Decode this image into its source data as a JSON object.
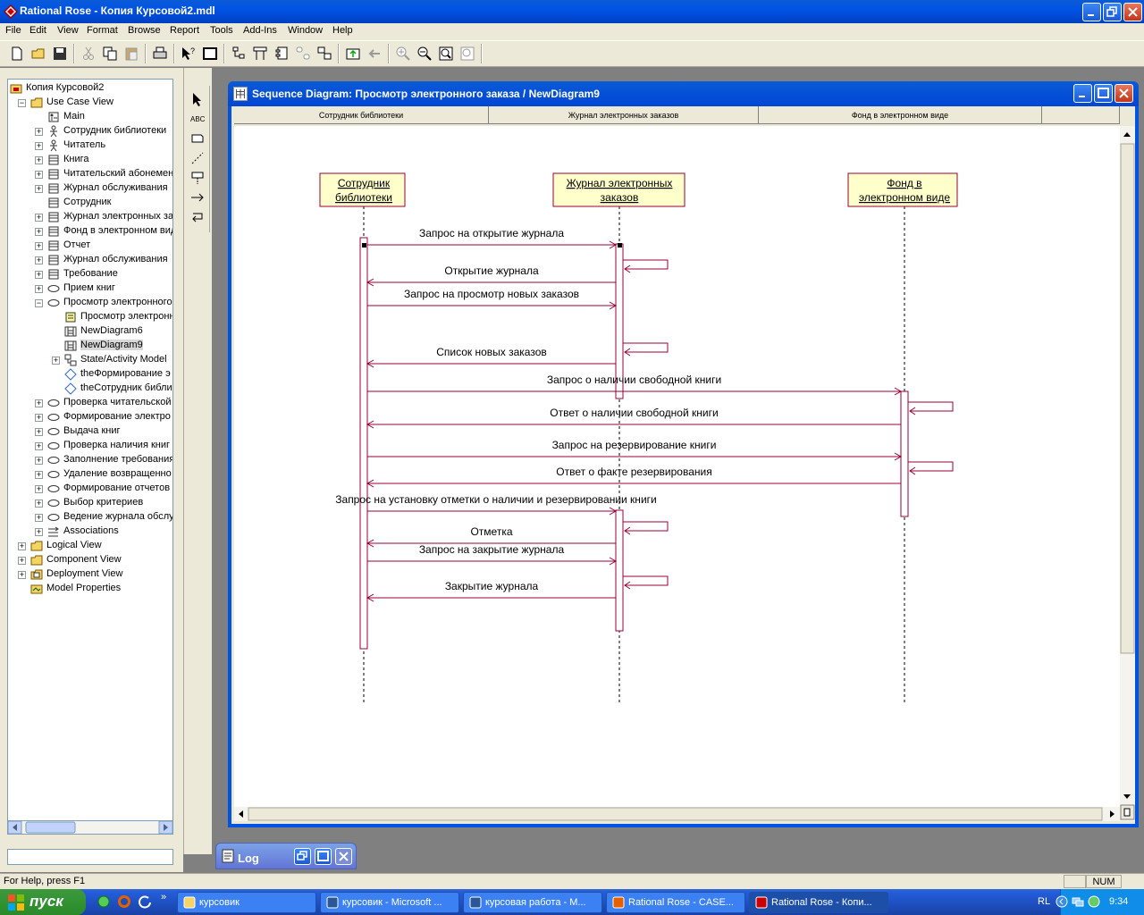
{
  "app": {
    "title": "Rational Rose - Копия Курсовой2.mdl"
  },
  "menu": [
    "File",
    "Edit",
    "View",
    "Format",
    "Browse",
    "Report",
    "Tools",
    "Add-Ins",
    "Window",
    "Help"
  ],
  "browser": {
    "items": [
      {
        "label": "Копия Курсовой2",
        "icon": "model-icon",
        "level": 0,
        "expander": ""
      },
      {
        "label": "Use Case View",
        "icon": "folder-icon",
        "level": 1,
        "expander": "-"
      },
      {
        "label": "Main",
        "icon": "diagram-icon",
        "level": 2,
        "expander": ""
      },
      {
        "label": "Сотрудник библиотеки",
        "icon": "actor-icon",
        "level": 2,
        "expander": "+"
      },
      {
        "label": "Читатель",
        "icon": "actor-icon",
        "level": 2,
        "expander": "+"
      },
      {
        "label": "Книга",
        "icon": "class-icon",
        "level": 2,
        "expander": "+"
      },
      {
        "label": "Читательский абонемент",
        "icon": "class-icon",
        "level": 2,
        "expander": "+"
      },
      {
        "label": "Журнал обслуживания",
        "icon": "class-icon",
        "level": 2,
        "expander": "+"
      },
      {
        "label": "Сотрудник",
        "icon": "class-icon",
        "level": 2,
        "expander": ""
      },
      {
        "label": "Журнал электронных заказов",
        "icon": "class-icon",
        "level": 2,
        "expander": "+"
      },
      {
        "label": "Фонд в электронном виде",
        "icon": "class-icon",
        "level": 2,
        "expander": "+"
      },
      {
        "label": "Отчет",
        "icon": "class-icon",
        "level": 2,
        "expander": "+"
      },
      {
        "label": "Журнал обслуживания",
        "icon": "class-icon",
        "level": 2,
        "expander": "+"
      },
      {
        "label": "Требование",
        "icon": "class-icon",
        "level": 2,
        "expander": "+"
      },
      {
        "label": "Прием книг",
        "icon": "usecase-icon",
        "level": 2,
        "expander": "+"
      },
      {
        "label": "Просмотр электронного заказа",
        "icon": "usecase-icon",
        "level": 2,
        "expander": "-"
      },
      {
        "label": "Просмотр электронного",
        "icon": "note-icon",
        "level": 3,
        "expander": ""
      },
      {
        "label": "NewDiagram6",
        "icon": "sequence-icon",
        "level": 3,
        "expander": ""
      },
      {
        "label": "NewDiagram9",
        "icon": "sequence-icon",
        "level": 3,
        "expander": "",
        "selected": true
      },
      {
        "label": "State/Activity Model",
        "icon": "state-icon",
        "level": 3,
        "expander": "+"
      },
      {
        "label": "theФормирование э",
        "icon": "object-icon",
        "level": 3,
        "expander": ""
      },
      {
        "label": "theСотрудник библи",
        "icon": "object-icon",
        "level": 3,
        "expander": ""
      },
      {
        "label": "Проверка читательской",
        "icon": "usecase-icon",
        "level": 2,
        "expander": "+"
      },
      {
        "label": "Формирование электро",
        "icon": "usecase-icon",
        "level": 2,
        "expander": "+"
      },
      {
        "label": "Выдача книг",
        "icon": "usecase-icon",
        "level": 2,
        "expander": "+"
      },
      {
        "label": "Проверка наличия книг",
        "icon": "usecase-icon",
        "level": 2,
        "expander": "+"
      },
      {
        "label": "Заполнение требования",
        "icon": "usecase-icon",
        "level": 2,
        "expander": "+"
      },
      {
        "label": "Удаление возвращенно",
        "icon": "usecase-icon",
        "level": 2,
        "expander": "+"
      },
      {
        "label": "Формирование отчетов",
        "icon": "usecase-icon",
        "level": 2,
        "expander": "+"
      },
      {
        "label": "Выбор критериев",
        "icon": "usecase-icon",
        "level": 2,
        "expander": "+"
      },
      {
        "label": "Ведение журнала обслу",
        "icon": "usecase-icon",
        "level": 2,
        "expander": "+"
      },
      {
        "label": "Associations",
        "icon": "association-icon",
        "level": 2,
        "expander": "+"
      },
      {
        "label": "Logical View",
        "icon": "folder-icon",
        "level": 1,
        "expander": "+"
      },
      {
        "label": "Component View",
        "icon": "folder-icon",
        "level": 1,
        "expander": "+"
      },
      {
        "label": "Deployment View",
        "icon": "deployment-icon",
        "level": 1,
        "expander": "+"
      },
      {
        "label": "Model Properties",
        "icon": "properties-icon",
        "level": 1,
        "expander": ""
      }
    ]
  },
  "diagram": {
    "title": "Sequence Diagram: Просмотр электронного заказа / NewDiagram9",
    "headers": [
      "Сотрудник библиотеки",
      "Журнал электронных заказов",
      "Фонд в электронном виде"
    ],
    "lifelines": [
      {
        "line1": "Сотрудник",
        "line2": "библиотеки"
      },
      {
        "line1": "Журнал электронных",
        "line2": "заказов"
      },
      {
        "line1": "Фонд в",
        "line2": "электронном виде"
      }
    ],
    "messages": [
      {
        "label": "Запрос на открытие журнала",
        "from": 0,
        "to": 1
      },
      {
        "label": "Открытие журнала",
        "from": 1,
        "to": 0
      },
      {
        "label": "Запрос на просмотр новых заказов",
        "from": 0,
        "to": 1
      },
      {
        "label": "Список новых заказов",
        "from": 1,
        "to": 0
      },
      {
        "label": "Запрос о наличии свободной книги",
        "from": 0,
        "to": 2
      },
      {
        "label": "Ответ о наличии свободной книги",
        "from": 2,
        "to": 0
      },
      {
        "label": "Запрос на резервирование книги",
        "from": 0,
        "to": 2
      },
      {
        "label": "Ответ о факте резервирования",
        "from": 2,
        "to": 0
      },
      {
        "label": "Запрос на установку отметки о наличии и резервировании книги",
        "from": 0,
        "to": 1
      },
      {
        "label": "Отметка",
        "from": 1,
        "to": 0
      },
      {
        "label": "Запрос на закрытие журнала",
        "from": 0,
        "to": 1
      },
      {
        "label": "Закрытие журнала",
        "from": 1,
        "to": 0
      }
    ]
  },
  "log": {
    "title": "Log"
  },
  "status": {
    "help": "For Help, press F1",
    "num": "NUM"
  },
  "taskbar": {
    "start": "пуск",
    "buttons": [
      {
        "label": "курсовик",
        "icon": "folder-icon"
      },
      {
        "label": "курсовик - Microsoft ...",
        "icon": "word-icon"
      },
      {
        "label": "курсовая работа - M...",
        "icon": "word-icon"
      },
      {
        "label": "Rational Rose - CASE...",
        "icon": "firefox-icon"
      },
      {
        "label": "Rational Rose - Копи...",
        "icon": "rose-icon",
        "active": true
      }
    ],
    "lang": "RL",
    "clock": "9:34"
  },
  "colors": {
    "xp_blue": "#0054e3",
    "message_line": "#990033",
    "lifeline_fill": "#ffffcc"
  }
}
